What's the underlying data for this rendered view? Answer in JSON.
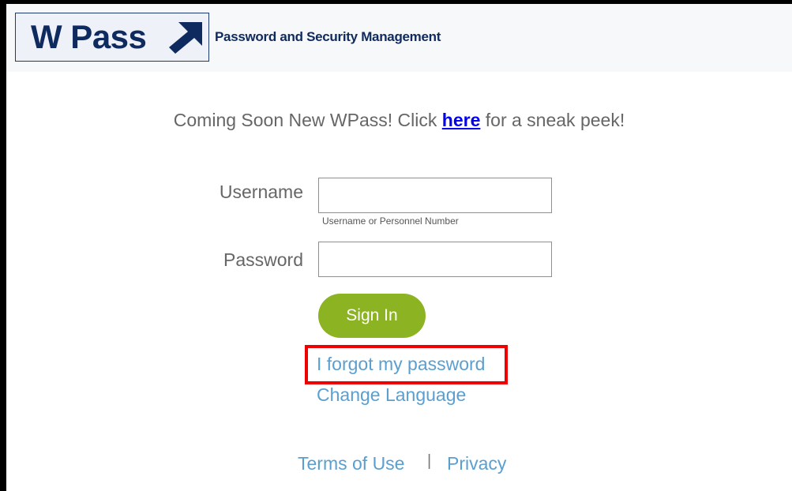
{
  "header": {
    "logo_text": "W Pass",
    "tagline": "Password and Security Management"
  },
  "promo": {
    "prefix": "Coming Soon New WPass! Click",
    "link_label": "here",
    "suffix": "for a sneak peek!"
  },
  "form": {
    "username_label": "Username",
    "username_value": "",
    "username_hint": "Username or Personnel Number",
    "password_label": "Password",
    "password_value": "",
    "signin_label": "Sign In"
  },
  "links": {
    "forgot_password": "I forgot my password",
    "change_language": "Change Language"
  },
  "footer": {
    "terms_label": "Terms of Use",
    "separator": "|",
    "privacy_label": "Privacy"
  },
  "colors": {
    "brand_navy": "#0f2a5f",
    "signin_green": "#8cb321",
    "link_blue": "#5a9fcf",
    "highlight_red": "#ee0000"
  }
}
